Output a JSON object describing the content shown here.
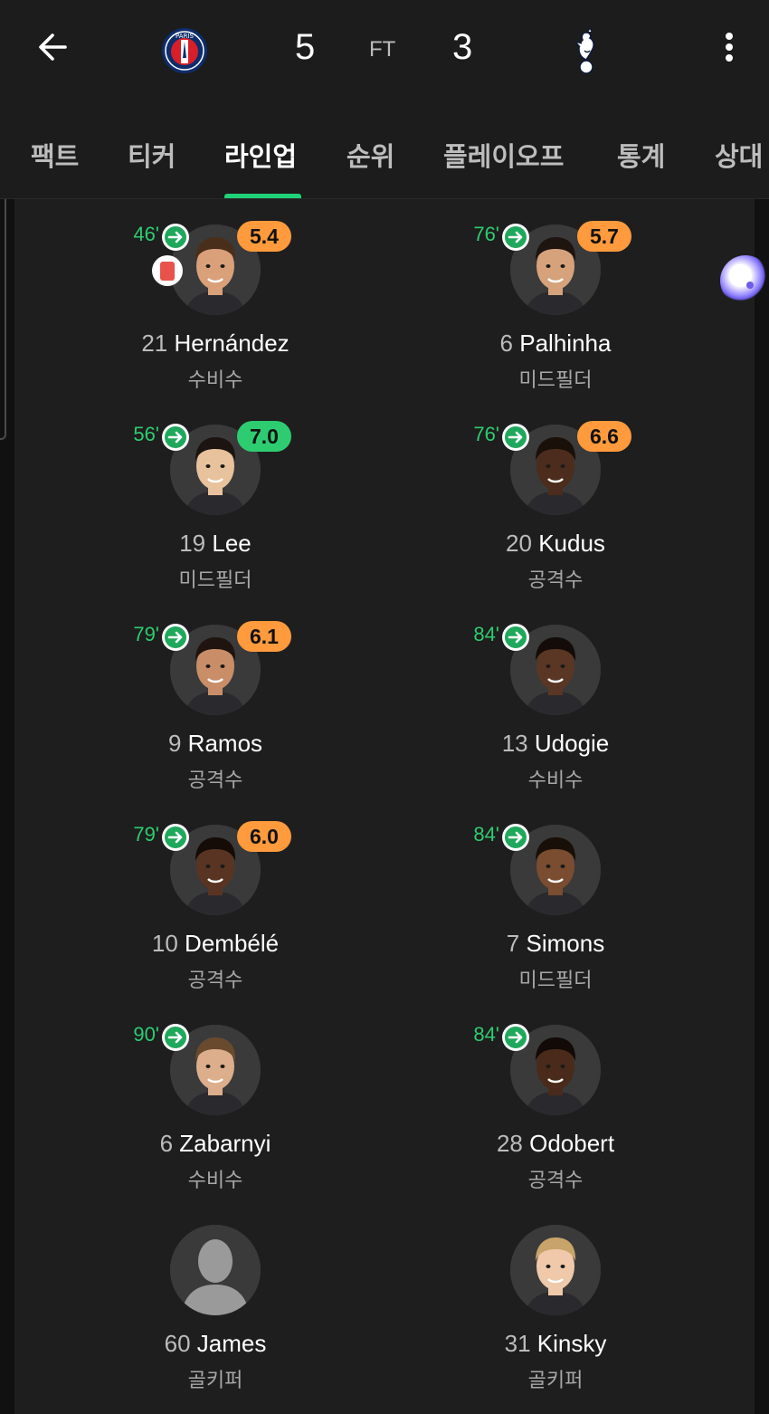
{
  "header": {
    "home_score": "5",
    "away_score": "3",
    "status": "FT",
    "home_team_logo": "psg-crest-icon",
    "away_team_logo": "tottenham-cockerel-icon",
    "psg_logo_text": "PARIS"
  },
  "tabs": [
    {
      "label": "팩트",
      "active": false
    },
    {
      "label": "티커",
      "active": false
    },
    {
      "label": "라인업",
      "active": true
    },
    {
      "label": "순위",
      "active": false
    },
    {
      "label": "플레이오프",
      "active": false
    },
    {
      "label": "통계",
      "active": false
    },
    {
      "label": "상대",
      "active": false
    }
  ],
  "colors": {
    "accent": "#1fd278",
    "sub_green": "#2ecc71",
    "rating_orange": "#ff9a3d",
    "rating_green": "#2ecc71",
    "red_card": "#e8524a"
  },
  "home_players": [
    {
      "number": "21",
      "name": "Hernández",
      "position": "수비수",
      "sub_time": "46'",
      "rating": "5.4",
      "rating_color": "#ff9a3d",
      "red_card": true,
      "skin": "#d9a07a",
      "hair": "#4a2e1c"
    },
    {
      "number": "19",
      "name": "Lee",
      "position": "미드필더",
      "sub_time": "56'",
      "rating": "7.0",
      "rating_color": "#2ecc71",
      "red_card": false,
      "skin": "#e8c29c",
      "hair": "#1c1410"
    },
    {
      "number": "9",
      "name": "Ramos",
      "position": "공격수",
      "sub_time": "79'",
      "rating": "6.1",
      "rating_color": "#ff9a3d",
      "red_card": false,
      "skin": "#c98e68",
      "hair": "#201410"
    },
    {
      "number": "10",
      "name": "Dembélé",
      "position": "공격수",
      "sub_time": "79'",
      "rating": "6.0",
      "rating_color": "#ff9a3d",
      "red_card": false,
      "skin": "#5a3422",
      "hair": "#150c08"
    },
    {
      "number": "6",
      "name": "Zabarnyi",
      "position": "수비수",
      "sub_time": "90'",
      "rating": "",
      "rating_color": "",
      "red_card": false,
      "skin": "#dcae8c",
      "hair": "#6a4a2e"
    },
    {
      "number": "60",
      "name": "James",
      "position": "골키퍼",
      "sub_time": "",
      "rating": "",
      "rating_color": "",
      "red_card": false,
      "placeholder": true
    }
  ],
  "away_players": [
    {
      "number": "6",
      "name": "Palhinha",
      "position": "미드필더",
      "sub_time": "76'",
      "rating": "5.7",
      "rating_color": "#ff9a3d",
      "red_card": false,
      "skin": "#d6a27c",
      "hair": "#1e1410"
    },
    {
      "number": "20",
      "name": "Kudus",
      "position": "공격수",
      "sub_time": "76'",
      "rating": "6.6",
      "rating_color": "#ff9a3d",
      "red_card": false,
      "skin": "#4c2c1c",
      "hair": "#1a100a"
    },
    {
      "number": "13",
      "name": "Udogie",
      "position": "수비수",
      "sub_time": "84'",
      "rating": "",
      "rating_color": "",
      "red_card": false,
      "skin": "#5a3624",
      "hair": "#140c08"
    },
    {
      "number": "7",
      "name": "Simons",
      "position": "미드필더",
      "sub_time": "84'",
      "rating": "",
      "rating_color": "",
      "red_card": false,
      "skin": "#7a4c30",
      "hair": "#181008"
    },
    {
      "number": "28",
      "name": "Odobert",
      "position": "공격수",
      "sub_time": "84'",
      "rating": "",
      "rating_color": "",
      "red_card": false,
      "skin": "#4a2a1a",
      "hair": "#120a06"
    },
    {
      "number": "31",
      "name": "Kinsky",
      "position": "골키퍼",
      "sub_time": "",
      "rating": "",
      "rating_color": "",
      "red_card": false,
      "skin": "#efc9aa",
      "hair": "#c9a46a"
    }
  ]
}
